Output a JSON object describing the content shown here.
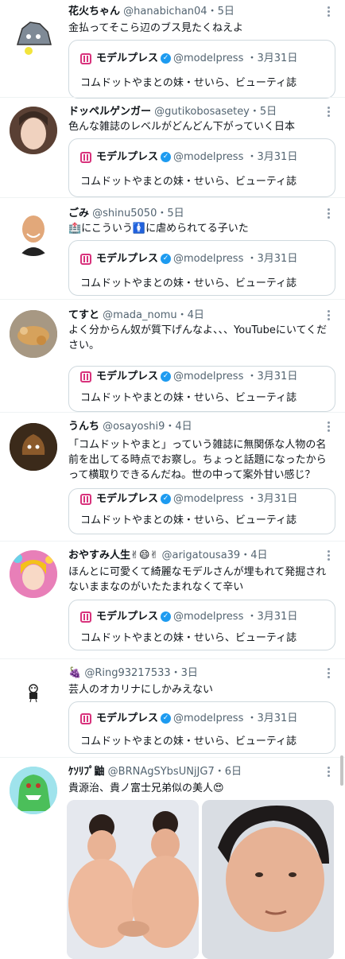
{
  "quote": {
    "name": "モデルプレス",
    "handle": "@modelpress",
    "time": "・3月31日",
    "text": "コムドットやまとの妹・せいら、ビューティ誌"
  },
  "tweets": [
    {
      "name": "花火ちゃん",
      "handle": "@hanabichan04",
      "time": "・5日",
      "text": "金払ってそこら辺のブス見たくねえよ"
    },
    {
      "name": "ドッペルゲンガー",
      "handle": "@gutikobosasetey",
      "time": "・5日",
      "text": "色んな雑誌のレベルがどんどん下がっていく日本"
    },
    {
      "name": "ごみ",
      "handle": "@shinu5050",
      "time": "・5日",
      "text": "🏥にこういう🚺に虐められてる子いた"
    },
    {
      "name": "てすと",
      "handle": "@mada_nomu",
      "time": "・4日",
      "text": "よく分からん奴が質下げんなよ、、、YouTubeにいてください。"
    },
    {
      "name": "うんち",
      "handle": "@osayoshi9",
      "time": "・4日",
      "text": "「コムドットやまと」っていう雑誌に無関係な人物の名前を出してる時点でお察し。ちょっと話題になったからって横取りできるんだね。世の中って案外甘い感じ？"
    },
    {
      "name": "おやすみ人生✌😄✌",
      "handle": "@arigatousa39",
      "time": "・4日",
      "text": "ほんとに可愛くて綺麗なモデルさんが埋もれて発掘されないままなのがいたたまれなくて辛い"
    },
    {
      "name": "🍇",
      "handle": "@Ring93217533",
      "time": "・3日",
      "text": "芸人のオカリナにしかみえない"
    },
    {
      "name": "ｹｿﾘﾌﾟ鼬",
      "handle": "@BRNAgSYbsUNjJG7",
      "time": "・6日",
      "text": "貴源治、貴ノ富士兄弟似の美人😍"
    }
  ],
  "colors": {
    "accent": "#1d9bf0",
    "brand": "#d8327c",
    "muted": "#536471",
    "border": "#cfd9de"
  }
}
